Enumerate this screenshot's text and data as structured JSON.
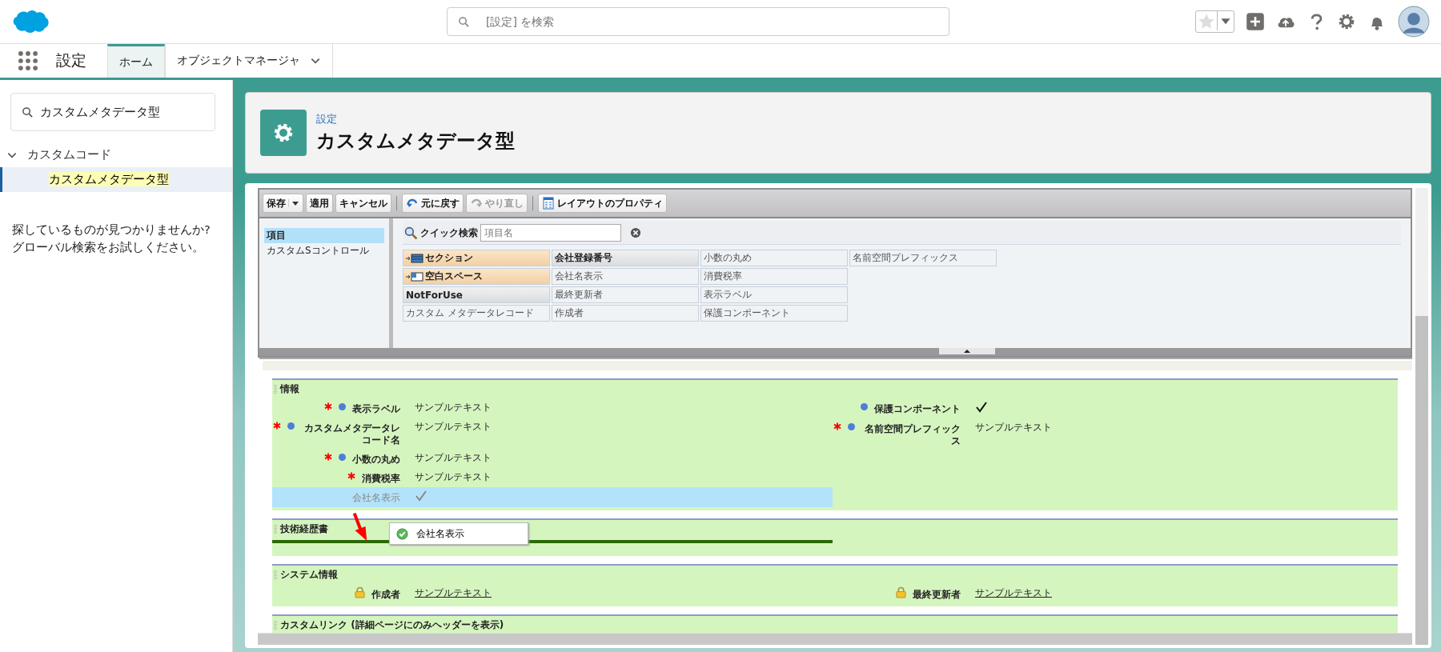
{
  "header": {
    "search": {
      "placeholder": "[設定] を検索"
    }
  },
  "nav": {
    "app_name": "設定",
    "tabs": [
      {
        "label": "ホーム",
        "selected": true,
        "dropdown": false
      },
      {
        "label": "オブジェクトマネージャ",
        "selected": false,
        "dropdown": true
      }
    ]
  },
  "sidebar": {
    "search": {
      "value": "カスタムメタデータ型"
    },
    "tree": [
      {
        "label": "カスタムコード",
        "expanded": true,
        "children": [
          {
            "label": "カスタムメタデータ型",
            "selected": true
          }
        ]
      }
    ],
    "help_text": [
      "探しているものが見つかりませんか?",
      "グローバル検索をお試しください。"
    ]
  },
  "page_header": {
    "breadcrumb": "設定",
    "title": "カスタムメタデータ型"
  },
  "editor": {
    "toolbar": [
      {
        "label": "保存",
        "kind": "split",
        "disabled": false
      },
      {
        "label": "適用",
        "kind": "plain",
        "disabled": false
      },
      {
        "label": "キャンセル",
        "kind": "plain",
        "disabled": false
      },
      {
        "label": "元に戻す",
        "kind": "undo",
        "disabled": false
      },
      {
        "label": "やり直し",
        "kind": "redo",
        "disabled": true
      },
      {
        "label": "レイアウトのプロパティ",
        "kind": "properties",
        "disabled": false
      }
    ],
    "categories": [
      {
        "label": "項目",
        "selected": true
      },
      {
        "label": "カスタムSコントロール",
        "selected": false
      }
    ],
    "quick_search": {
      "label": "クイック検索",
      "placeholder": "項目名"
    },
    "palette": [
      {
        "label": "セクション",
        "kind": "section",
        "used": false
      },
      {
        "label": "空白スペース",
        "kind": "blank",
        "used": false
      },
      {
        "label": "NotForUse",
        "kind": "field",
        "used": false
      },
      {
        "label": "カスタム メタデータレコード",
        "kind": "field",
        "used": true
      },
      {
        "label": "会社登録番号",
        "kind": "field",
        "used": false
      },
      {
        "label": "会社名表示",
        "kind": "field",
        "used": true
      },
      {
        "label": "最終更新者",
        "kind": "field",
        "used": true
      },
      {
        "label": "作成者",
        "kind": "field",
        "used": true
      },
      {
        "label": "小数の丸め",
        "kind": "field",
        "used": true
      },
      {
        "label": "消費税率",
        "kind": "field",
        "used": true
      },
      {
        "label": "表示ラベル",
        "kind": "field",
        "used": true
      },
      {
        "label": "保護コンポーネント",
        "kind": "field",
        "used": true
      },
      {
        "label": "名前空間プレフィックス",
        "kind": "field",
        "used": true
      }
    ],
    "sections": [
      {
        "title": "情報",
        "drop_target": false,
        "columns": [
          [
            {
              "label": "表示ラベル",
              "required": true,
              "flagged": true,
              "lock": false,
              "highlighted": false,
              "kind": "text",
              "value": "サンプルテキスト"
            },
            {
              "label": "カスタムメタデータレコード名",
              "required": true,
              "flagged": true,
              "lock": false,
              "highlighted": false,
              "kind": "text",
              "value": "サンプルテキスト"
            },
            {
              "label": "小数の丸め",
              "required": true,
              "flagged": true,
              "lock": false,
              "highlighted": false,
              "kind": "text",
              "value": "サンプルテキスト"
            },
            {
              "label": "消費税率",
              "required": true,
              "flagged": false,
              "lock": false,
              "highlighted": false,
              "kind": "text",
              "value": "サンプルテキスト"
            },
            {
              "label": "会社名表示",
              "required": false,
              "flagged": false,
              "lock": false,
              "highlighted": true,
              "kind": "checkbox",
              "checked": true
            }
          ],
          [
            {
              "label": "保護コンポーネント",
              "required": false,
              "flagged": true,
              "lock": false,
              "highlighted": false,
              "kind": "checkbox",
              "checked": true
            },
            {
              "label": "名前空間プレフィックス",
              "required": true,
              "flagged": true,
              "lock": false,
              "highlighted": false,
              "kind": "text",
              "value": "サンプルテキスト"
            }
          ]
        ]
      },
      {
        "title": "技術経歴書",
        "drop_target": true,
        "columns": [
          [],
          []
        ]
      },
      {
        "title": "システム情報",
        "drop_target": false,
        "columns": [
          [
            {
              "label": "作成者",
              "required": false,
              "flagged": false,
              "lock": true,
              "highlighted": false,
              "kind": "link",
              "value": "サンプルテキスト"
            }
          ],
          [
            {
              "label": "最終更新者",
              "required": false,
              "flagged": false,
              "lock": true,
              "highlighted": false,
              "kind": "link",
              "value": "サンプルテキスト"
            }
          ]
        ]
      },
      {
        "title": "カスタムリンク (詳細ページにのみヘッダーを表示)",
        "drop_target": false,
        "columns": [
          [],
          []
        ]
      }
    ],
    "drag_tooltip": {
      "label": "会社名表示"
    }
  }
}
